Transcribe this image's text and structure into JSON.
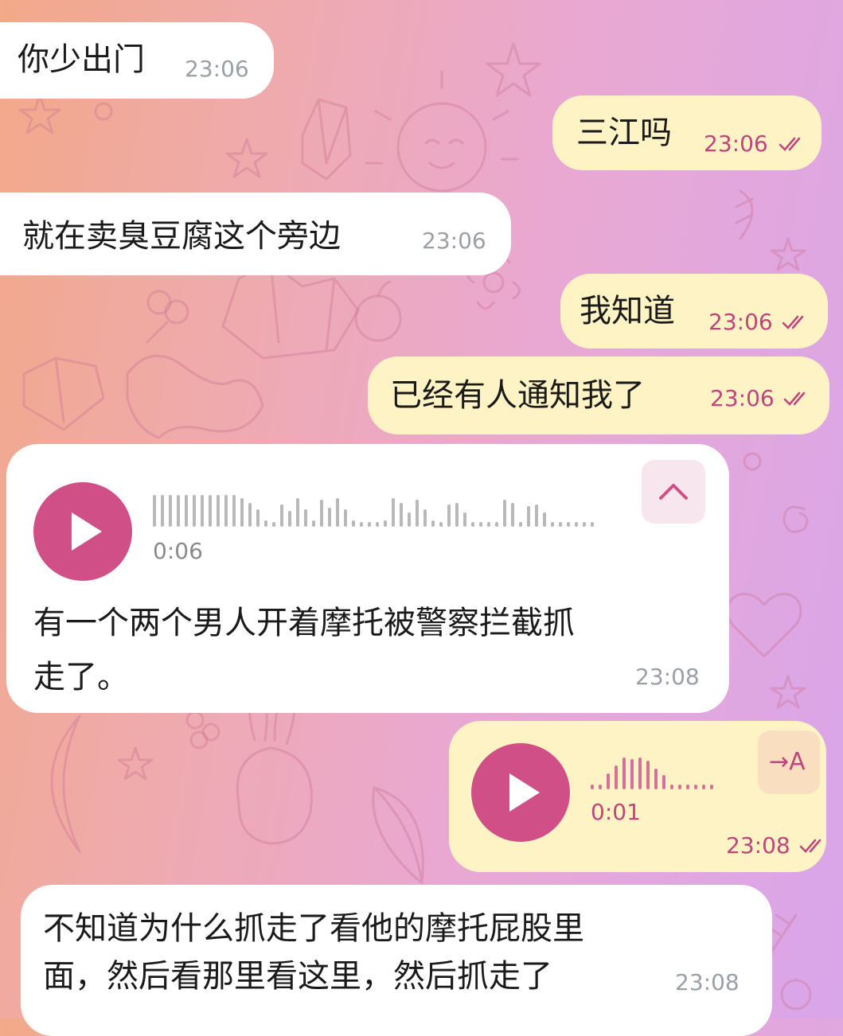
{
  "background": {
    "gradient_left": "#f2a989",
    "gradient_right": "#d9a6ea"
  },
  "accent_color": "#cf4f86",
  "messages": [
    {
      "side": "in",
      "text": "你少出门",
      "time": "23:06"
    },
    {
      "side": "out",
      "text": "三江吗",
      "time": "23:06",
      "status": "read"
    },
    {
      "side": "in",
      "text": "就在卖臭豆腐这个旁边",
      "time": "23:06"
    },
    {
      "side": "out",
      "text": "我知道",
      "time": "23:06",
      "status": "read"
    },
    {
      "side": "out",
      "text": "已经有人通知我了",
      "time": "23:06",
      "status": "read"
    },
    {
      "side": "in",
      "type": "voice",
      "duration": "0:06",
      "transcript_line1": "有一个两个男人开着摩托被警察拦截抓",
      "transcript_line2": "走了。",
      "time": "23:08",
      "collapse_icon": "chevron-up-icon"
    },
    {
      "side": "out",
      "type": "voice",
      "duration": "0:01",
      "transcribe_label": "→A",
      "time": "23:08",
      "status": "read"
    },
    {
      "side": "in",
      "text_line1": "不知道为什么抓走了看他的摩托屁股里",
      "text_line2": "面，然后看那里看这里，然后抓走了",
      "time": "23:08"
    }
  ]
}
